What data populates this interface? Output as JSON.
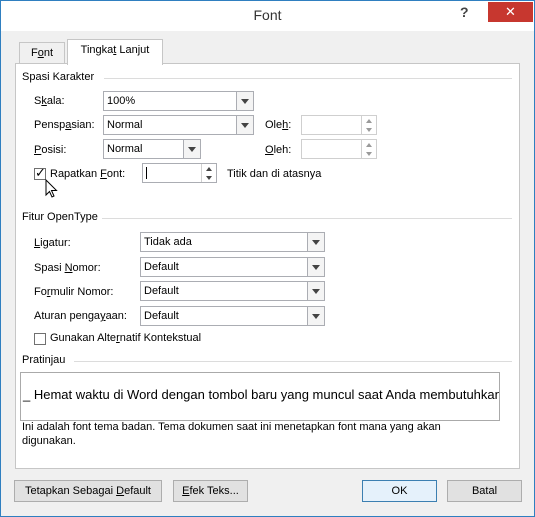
{
  "window": {
    "title": "Font",
    "help_label": "?",
    "close_label": "✕"
  },
  "tabs": [
    {
      "label": "Font",
      "underline_index": 1
    },
    {
      "label": "Tingkat Lanjut",
      "underline_index": 6
    }
  ],
  "spasi_karakter": {
    "title": "Spasi Karakter",
    "skala": {
      "label_pre": "S",
      "label_u": "k",
      "label_post": "ala:",
      "value": "100%"
    },
    "penspasian": {
      "label_pre": "Pensp",
      "label_u": "a",
      "label_post": "sian:",
      "value": "Normal"
    },
    "posisi": {
      "label_pre": "",
      "label_u": "P",
      "label_post": "osisi:",
      "value": "Normal"
    },
    "oleh1": {
      "label_pre": "Ole",
      "label_u": "h",
      "label_post": ":",
      "value": ""
    },
    "oleh2": {
      "label_pre": "",
      "label_u": "O",
      "label_post": "leh:",
      "value": ""
    },
    "rapatkan": {
      "label_pre": "Rapatkan ",
      "label_u": "F",
      "label_post": "ont:",
      "checked": true,
      "value": ""
    },
    "suffix": "Titik dan di atasnya"
  },
  "fitur_opentype": {
    "title": "Fitur OpenType",
    "ligatur": {
      "label_pre": "",
      "label_u": "L",
      "label_post": "igatur:",
      "value": "Tidak ada"
    },
    "spasi_nomor": {
      "label_pre": "Spasi ",
      "label_u": "N",
      "label_post": "omor:",
      "value": "Default"
    },
    "formulir_nomor": {
      "label_pre": "Fo",
      "label_u": "r",
      "label_post": "mulir Nomor:",
      "value": "Default"
    },
    "aturan": {
      "label_pre": "Aturan penga",
      "label_u": "y",
      "label_post": "aan:",
      "value": "Default"
    },
    "alternatif": {
      "label_pre": "Gunakan Alte",
      "label_u": "r",
      "label_post": "natif Kontekstual",
      "checked": false
    }
  },
  "pratinjau": {
    "title": "Pratinjau",
    "preview_text": "_ Hemat waktu di Word dengan tombol baru yang muncul saat Anda membutuhkannya.",
    "description_line1": "Ini adalah font tema badan. Tema dokumen saat ini menetapkan font mana yang akan",
    "description_line2": "digunakan."
  },
  "buttons": {
    "set_default": {
      "label_pre": "Tetapkan Sebagai ",
      "label_u": "D",
      "label_post": "efault"
    },
    "text_effects": {
      "label_pre": "",
      "label_u": "E",
      "label_post": "fek Teks..."
    },
    "ok": "OK",
    "cancel": "Batal"
  },
  "colors": {
    "accent": "#2f7fc0",
    "close": "#c7372f",
    "dialog_bg": "#f0f0f0"
  }
}
